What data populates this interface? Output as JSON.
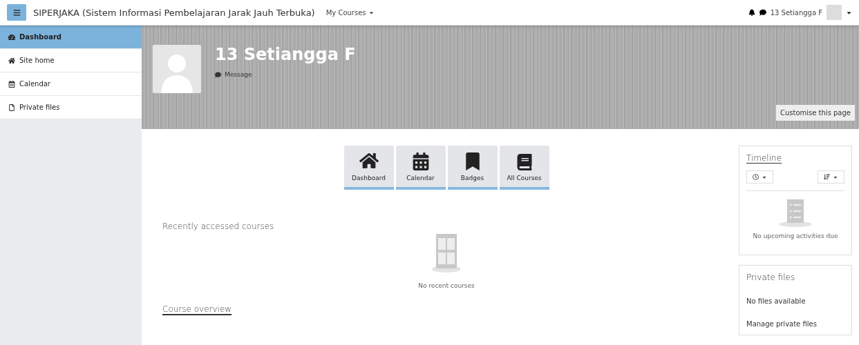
{
  "navbar": {
    "site_title": "SIPERJAKA (Sistem Informasi Pembelajaran Jarak Jauh Terbuka)",
    "menu": "My Courses",
    "user_name": "13 Setiangga F"
  },
  "sidebar": {
    "items": [
      {
        "label": "Dashboard",
        "kind": "dashboard",
        "selected": true
      },
      {
        "label": "Site home",
        "kind": "home",
        "selected": false
      },
      {
        "label": "Calendar",
        "kind": "calendar",
        "selected": false
      },
      {
        "label": "Private files",
        "kind": "file",
        "selected": false
      }
    ]
  },
  "header": {
    "name": "13 Setiangga F",
    "message": "Message",
    "customise_button": "Customise this page"
  },
  "shortcuts": [
    {
      "label": "Dashboard",
      "kind": "home"
    },
    {
      "label": "Calendar",
      "kind": "calendar"
    },
    {
      "label": "Badges",
      "kind": "badge"
    },
    {
      "label": "All Courses",
      "kind": "book"
    }
  ],
  "recent": {
    "title": "Recently accessed courses",
    "empty": "No recent courses"
  },
  "overview": {
    "title": "Course overview"
  },
  "timeline": {
    "title": "Timeline",
    "empty": "No upcoming activities due"
  },
  "private_files": {
    "title": "Private files",
    "empty": "No files available",
    "link": "Manage private files"
  }
}
